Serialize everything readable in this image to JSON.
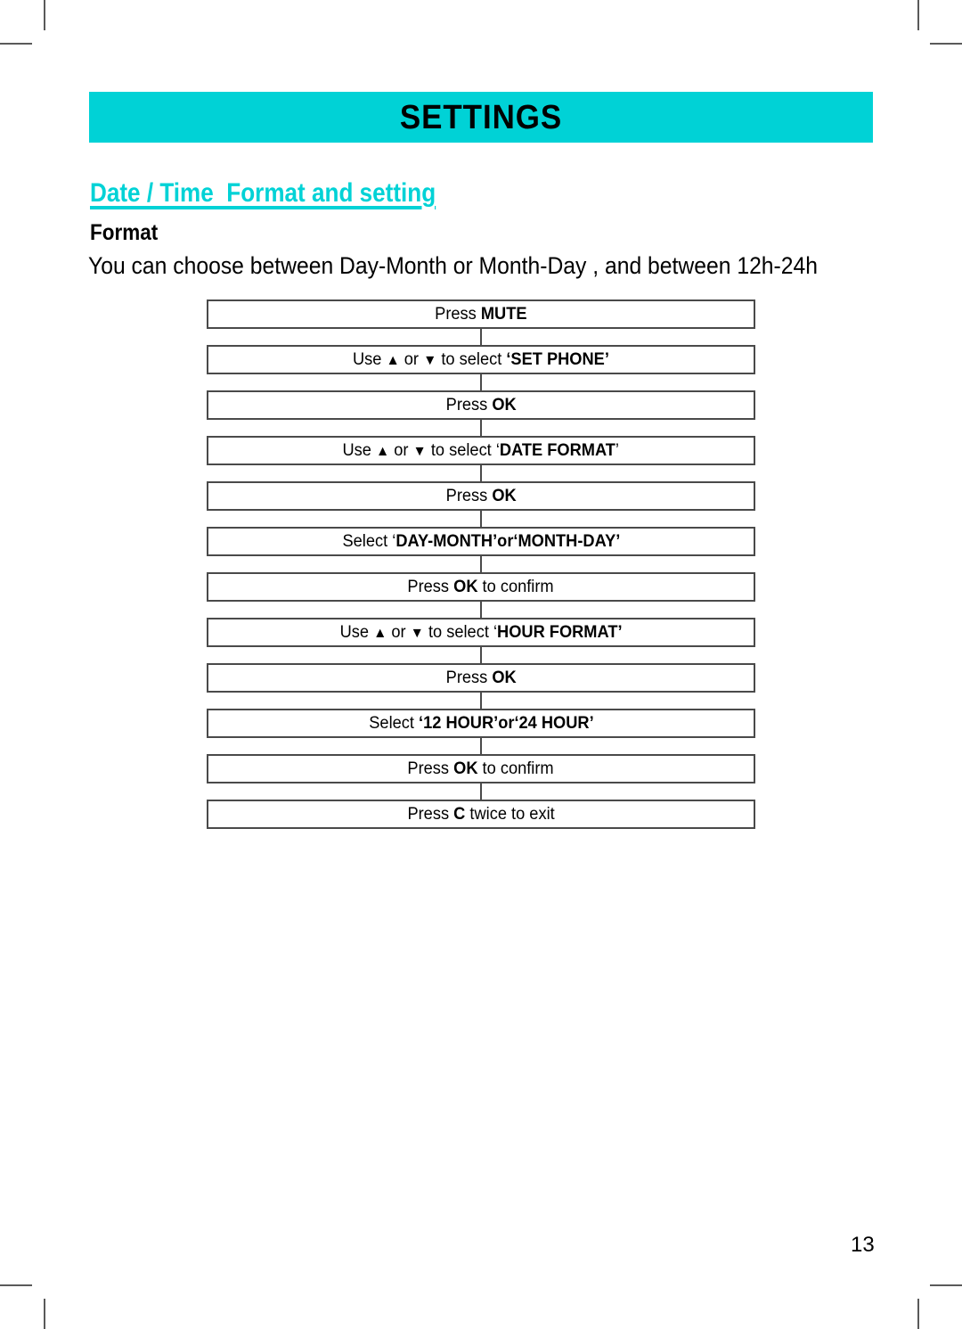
{
  "banner": {
    "title": "SETTINGS"
  },
  "section": {
    "heading": "Date / Time  Format and setting",
    "sub_heading": "Format",
    "intro": "You can choose between Day-Month or Month-Day , and between 12h-24h"
  },
  "flowchart": {
    "steps": [
      {
        "id": "press-mute",
        "plain": "Press MUTE",
        "parts": [
          {
            "text": "Press ",
            "bold": false
          },
          {
            "text": "MUTE",
            "bold": true
          }
        ]
      },
      {
        "id": "select-set-phone",
        "plain": "Use ▲ or ▼ to select ‘SET PHONE’",
        "parts": [
          {
            "text": "Use ",
            "bold": false
          },
          {
            "text": "▲",
            "bold": false,
            "icon": "up-arrow-icon"
          },
          {
            "text": " or ",
            "bold": false
          },
          {
            "text": "▼",
            "bold": false,
            "icon": "down-arrow-icon"
          },
          {
            "text": " to select ",
            "bold": false
          },
          {
            "text": "‘SET PHONE’",
            "bold": true
          }
        ]
      },
      {
        "id": "press-ok-1",
        "plain": "Press OK",
        "parts": [
          {
            "text": "Press ",
            "bold": false
          },
          {
            "text": "OK",
            "bold": true
          }
        ]
      },
      {
        "id": "select-date-format",
        "plain": "Use ▲ or ▼ to select ‘DATE FORMAT’",
        "parts": [
          {
            "text": "Use ",
            "bold": false
          },
          {
            "text": "▲",
            "bold": false,
            "icon": "up-arrow-icon"
          },
          {
            "text": " or ",
            "bold": false
          },
          {
            "text": "▼",
            "bold": false,
            "icon": "down-arrow-icon"
          },
          {
            "text": " to select ",
            "bold": false
          },
          {
            "text": "‘",
            "bold": false
          },
          {
            "text": "DATE FORMAT",
            "bold": true
          },
          {
            "text": "’",
            "bold": false
          }
        ]
      },
      {
        "id": "press-ok-2",
        "plain": "Press OK",
        "parts": [
          {
            "text": "Press ",
            "bold": false
          },
          {
            "text": "OK",
            "bold": true
          }
        ]
      },
      {
        "id": "select-day-month-or-month-day",
        "plain": "Select ‘DAY-MONTH’or‘MONTH-DAY’",
        "parts": [
          {
            "text": "Select ",
            "bold": false
          },
          {
            "text": "‘",
            "bold": false
          },
          {
            "text": "DAY-MONTH’or‘MONTH-DAY’",
            "bold": true
          }
        ]
      },
      {
        "id": "press-ok-to-confirm-1",
        "plain": "Press OK to confirm",
        "parts": [
          {
            "text": "Press ",
            "bold": false
          },
          {
            "text": "OK",
            "bold": true
          },
          {
            "text": " to confirm",
            "bold": false
          }
        ]
      },
      {
        "id": "select-hour-format",
        "plain": "Use ▲ or ▼ to select ‘HOUR FORMAT’",
        "parts": [
          {
            "text": "Use ",
            "bold": false
          },
          {
            "text": "▲",
            "bold": false,
            "icon": "up-arrow-icon"
          },
          {
            "text": " or ",
            "bold": false
          },
          {
            "text": "▼",
            "bold": false,
            "icon": "down-arrow-icon"
          },
          {
            "text": " to select ",
            "bold": false
          },
          {
            "text": "‘",
            "bold": false
          },
          {
            "text": "HOUR FORMAT’",
            "bold": true
          }
        ]
      },
      {
        "id": "press-ok-3",
        "plain": "Press OK",
        "parts": [
          {
            "text": "Press ",
            "bold": false
          },
          {
            "text": "OK",
            "bold": true
          }
        ]
      },
      {
        "id": "select-12-hour-or-24-hour",
        "plain": "Select ‘12 HOUR’or‘24 HOUR’",
        "parts": [
          {
            "text": "Select ",
            "bold": false
          },
          {
            "text": "‘12 HOUR’or‘24 HOUR’",
            "bold": true
          }
        ]
      },
      {
        "id": "press-ok-to-confirm-2",
        "plain": "Press OK to confirm",
        "parts": [
          {
            "text": "Press ",
            "bold": false
          },
          {
            "text": "OK",
            "bold": true
          },
          {
            "text": " to confirm",
            "bold": false
          }
        ]
      },
      {
        "id": "press-c-twice-to-exit",
        "plain": "Press C twice to exit",
        "parts": [
          {
            "text": "Press ",
            "bold": false
          },
          {
            "text": "C",
            "bold": true
          },
          {
            "text": " twice to exit",
            "bold": false
          }
        ]
      }
    ]
  },
  "footer": {
    "page_number": "13"
  },
  "colors": {
    "accent": "#00d2d6",
    "box_border": "#4a4a4a",
    "text": "#000000",
    "crop_mark": "#5a5a5a"
  }
}
